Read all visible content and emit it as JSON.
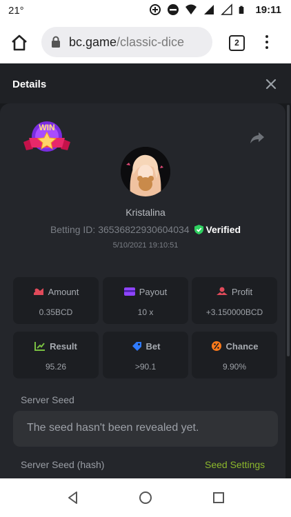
{
  "status_bar": {
    "left_text": "21°",
    "time": "19:11"
  },
  "browser": {
    "url_host": "bc.game",
    "url_path": "/classic-dice",
    "tab_count": "2"
  },
  "details": {
    "title": "Details",
    "badge_text": "WIN",
    "username": "Kristalina",
    "betting_id_label": "Betting ID: 36536822930604034",
    "verified_label": "Verified",
    "date": "5/10/2021 19:10:51"
  },
  "cards": [
    {
      "label": "Amount",
      "value": "0.35BCD",
      "icon": "amount-icon",
      "color": "#e04a5a"
    },
    {
      "label": "Payout",
      "value": "10 x",
      "icon": "payout-icon",
      "color": "#8e44ff"
    },
    {
      "label": "Profit",
      "value": "+3.150000BCD",
      "icon": "profit-icon",
      "color": "#e04a5a"
    },
    {
      "label": "Result",
      "value": "95.26",
      "icon": "result-icon",
      "color": "#7ac142"
    },
    {
      "label": "Bet",
      "value": ">90.1",
      "icon": "bet-icon",
      "color": "#2f7bff"
    },
    {
      "label": "Chance",
      "value": "9.90%",
      "icon": "chance-icon",
      "color": "#ff7a1a"
    }
  ],
  "seed": {
    "server_seed_label": "Server Seed",
    "server_seed_value": "The seed hasn't been revealed yet.",
    "server_seed_hash_label": "Server Seed (hash)",
    "seed_settings_label": "Seed Settings"
  },
  "colors": {
    "verified_green": "#2fd060",
    "accent_green": "#8cb82c",
    "panel_bg": "#24262b",
    "card_bg": "#1c1e22"
  }
}
